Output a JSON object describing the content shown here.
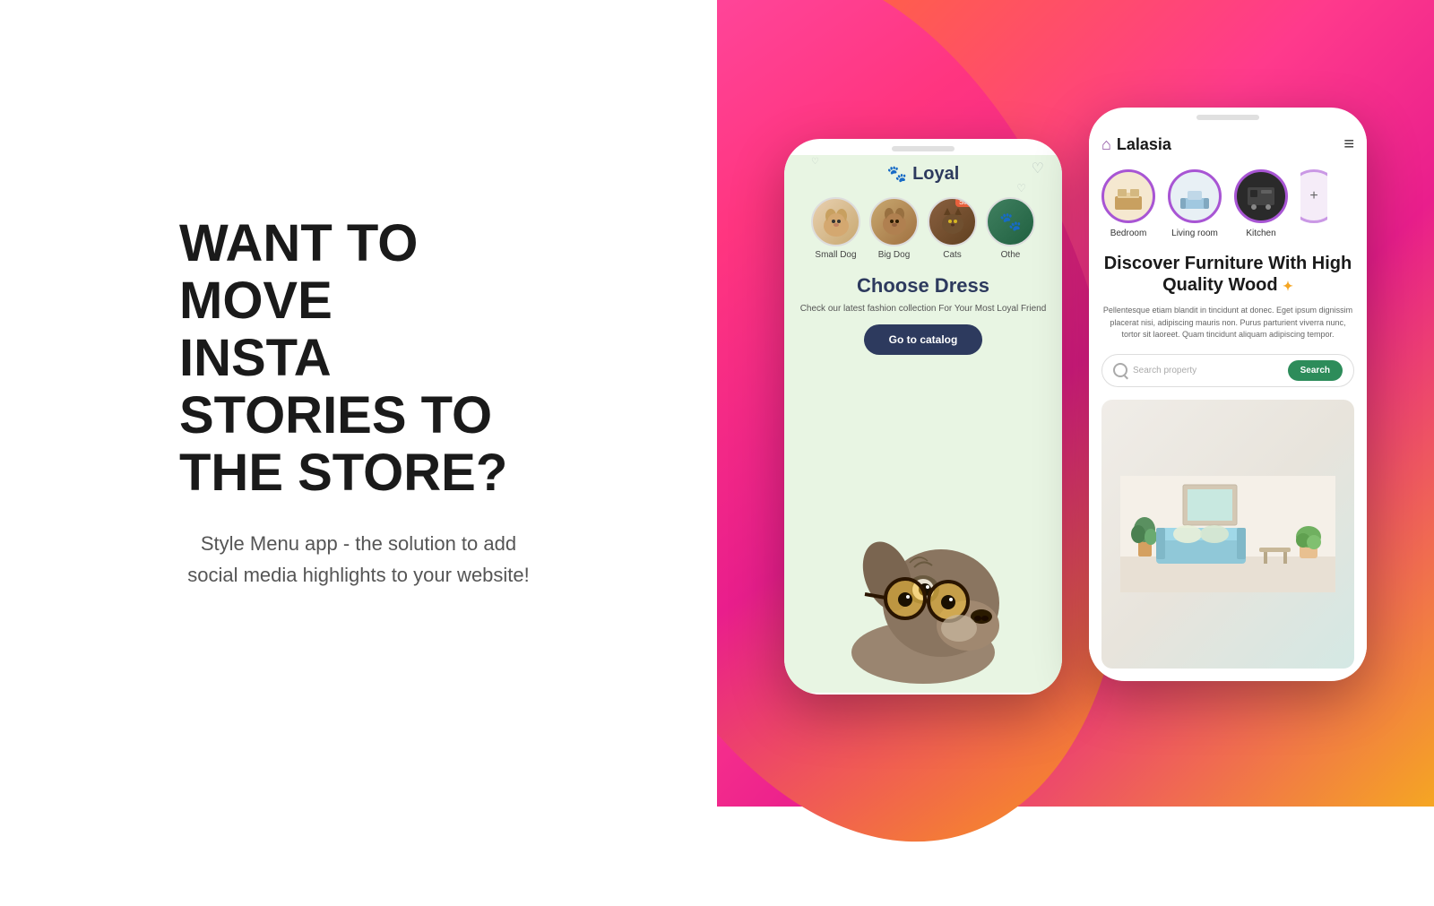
{
  "left": {
    "headline_line1": "WANT TO MOVE",
    "headline_line2": "INSTA STORIES TO",
    "headline_line3": "THE STORE?",
    "subtext": "Style Menu app - the solution to add social media highlights to your website!"
  },
  "phone1": {
    "app_name": "Loyal",
    "categories": [
      {
        "label": "Small Dog",
        "emoji": "🐕",
        "sale": false
      },
      {
        "label": "Big Dog",
        "emoji": "🐕",
        "sale": false
      },
      {
        "label": "Cats",
        "emoji": "🐈",
        "sale": true
      },
      {
        "label": "Othe",
        "emoji": "🐾",
        "sale": false
      }
    ],
    "section_title": "Choose Dress",
    "section_sub": "Check our latest fashion collection For Your Most Loyal Friend",
    "cta_button": "Go to catalog"
  },
  "phone2": {
    "app_name": "Lalasia",
    "rooms": [
      {
        "label": "Bedroom",
        "type": "bedroom"
      },
      {
        "label": "Living room",
        "type": "living"
      },
      {
        "label": "Kitchen",
        "type": "kitchen"
      }
    ],
    "headline": "Discover Furniture With High Quality Wood",
    "description": "Pellentesque etiam blandit in tincidunt at donec. Eget ipsum dignissim placerat nisi, adipiscing mauris non. Purus parturient viverra nunc, tortor sit laoreet. Quam tincidunt aliquam adipiscing tempor.",
    "search_placeholder": "Search property",
    "search_button": "Search"
  },
  "colors": {
    "accent_pink": "#ff3a8c",
    "accent_orange": "#f7971e",
    "dark_navy": "#2d3a5e",
    "green_search": "#2d8c5a",
    "purple": "#a855d4"
  }
}
